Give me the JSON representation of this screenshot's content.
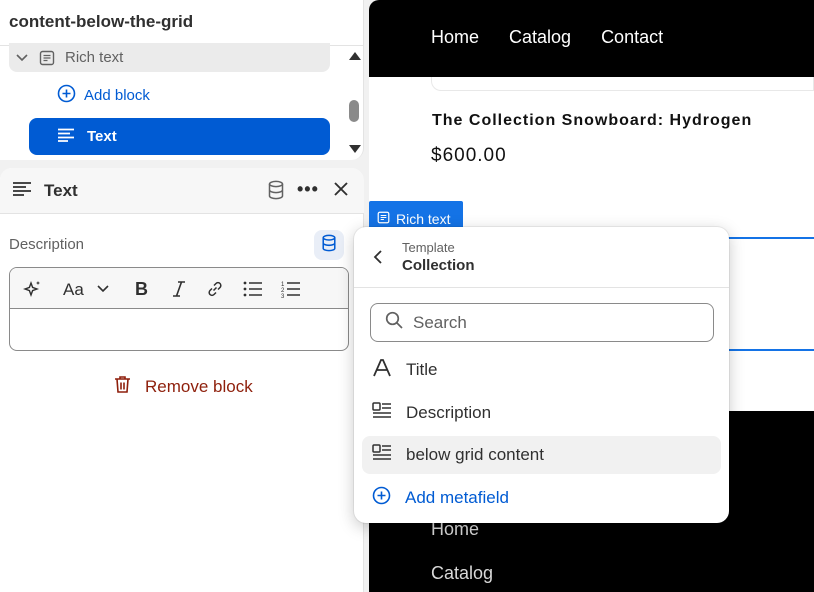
{
  "tree": {
    "title": "content-below-the-grid",
    "rich_text_label": "Rich text",
    "add_block_label": "Add block",
    "text_label": "Text"
  },
  "settings": {
    "title": "Text",
    "more_label": "•••",
    "description_label": "Description",
    "remove_block_label": "Remove block",
    "editor_value": ""
  },
  "preview": {
    "nav": [
      "Home",
      "Catalog",
      "Contact"
    ],
    "product_title": "The Collection Snowboard: Hydrogen",
    "price": "$600.00",
    "rich_text_tag": "Rich text",
    "footer_links": [
      "Home",
      "Catalog"
    ]
  },
  "popover": {
    "subtitle": "Template",
    "title": "Collection",
    "search_placeholder": "Search",
    "items": [
      {
        "label": "Title",
        "icon": "text-format-icon"
      },
      {
        "label": "Description",
        "icon": "text-block-icon"
      },
      {
        "label": "below grid content",
        "icon": "text-block-icon"
      }
    ],
    "add_label": "Add metafield"
  },
  "colors": {
    "accent": "#005bd3",
    "danger": "#8e1f0b",
    "preview_blue": "#1473e6"
  }
}
